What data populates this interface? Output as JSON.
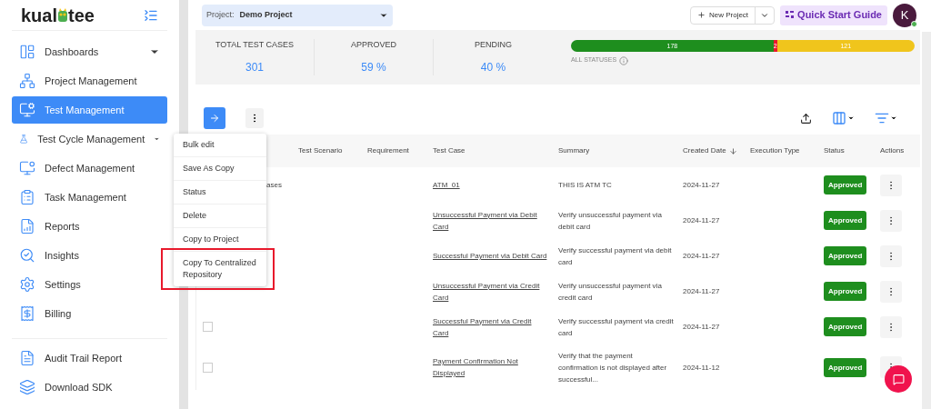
{
  "logo": {
    "before": "kual",
    "after": "tee"
  },
  "sidebar": {
    "items": [
      {
        "label": "Dashboards",
        "selected": false,
        "expanded": false
      },
      {
        "label": "Project Management",
        "selected": false
      },
      {
        "label": "Test Management",
        "selected": true
      },
      {
        "label": "Test Cycle Management",
        "selected": false,
        "expanded": false
      },
      {
        "label": "Defect Management",
        "selected": false
      },
      {
        "label": "Task Management",
        "selected": false
      },
      {
        "label": "Reports",
        "selected": false
      },
      {
        "label": "Insights",
        "selected": false
      },
      {
        "label": "Settings",
        "selected": false
      },
      {
        "label": "Billing",
        "selected": false
      }
    ],
    "footer_items": [
      {
        "label": "Audit Trail Report",
        "selected": false
      },
      {
        "label": "Download SDK",
        "selected": false
      }
    ]
  },
  "project_selector": {
    "label": "Project:",
    "value": "Demo Project"
  },
  "header": {
    "new_project": "New Project",
    "quick_start": "Quick Start Guide",
    "avatar": "K",
    "online": true
  },
  "stats": [
    {
      "label": "TOTAL TEST CASES",
      "value": "301"
    },
    {
      "label": "APPROVED",
      "value": "59 %"
    },
    {
      "label": "PENDING",
      "value": "40 %"
    }
  ],
  "status_bar": {
    "caption": "ALL STATUSES",
    "segments": [
      {
        "value": "178",
        "color": "#1e8e1e"
      },
      {
        "value": "2",
        "color": "#e8192c"
      },
      {
        "value": "121",
        "color": "#f0c51c"
      }
    ]
  },
  "menu": {
    "items": [
      {
        "label": "Bulk edit",
        "highlighted": false
      },
      {
        "label": "Save As Copy",
        "highlighted": false
      },
      {
        "label": "Status",
        "highlighted": false
      },
      {
        "label": "Delete",
        "highlighted": false
      },
      {
        "label": "Copy to Project",
        "highlighted": false
      },
      {
        "label": "Copy To Centralized Repository",
        "highlighted": true
      }
    ]
  },
  "table": {
    "columns": [
      {
        "label": "Test Scenario",
        "sorted": false
      },
      {
        "label": "Requirement",
        "sorted": false
      },
      {
        "label": "Test Case",
        "sorted": false
      },
      {
        "label": "Summary",
        "sorted": false
      },
      {
        "label": "Created Date",
        "sorted": true
      },
      {
        "label": "Execution Type",
        "sorted": false
      },
      {
        "label": "Status",
        "sorted": false
      },
      {
        "label": "Actions",
        "sorted": false
      }
    ],
    "rows": [
      {
        "column_2": "ases",
        "test_case": "ATM_01",
        "summary": "THIS IS ATM TC",
        "created": "2024-11-27",
        "status": "Approved"
      },
      {
        "test_case": "Unsuccessful Payment via Debit Card",
        "summary": "Verify unsuccessful payment via debit card",
        "created": "2024-11-27",
        "status": "Approved"
      },
      {
        "test_case": "Successful Payment via Debit Card",
        "summary": "Verify successful payment via debit card",
        "created": "2024-11-27",
        "status": "Approved"
      },
      {
        "test_case": "Unsuccessful Payment via Credit Card",
        "summary": "Verify unsuccessful payment via credit card",
        "created": "2024-11-27",
        "status": "Approved"
      },
      {
        "checked": false,
        "test_case": "Successful Payment via Credit Card",
        "summary": "Verify successful payment via credit card",
        "created": "2024-11-27",
        "status": "Approved"
      },
      {
        "checked": false,
        "test_case": "Payment Confirmation Not Displayed",
        "summary": "Verify that the payment confirmation is not displayed after successful...",
        "created": "2024-11-12",
        "status": "Approved"
      }
    ]
  }
}
